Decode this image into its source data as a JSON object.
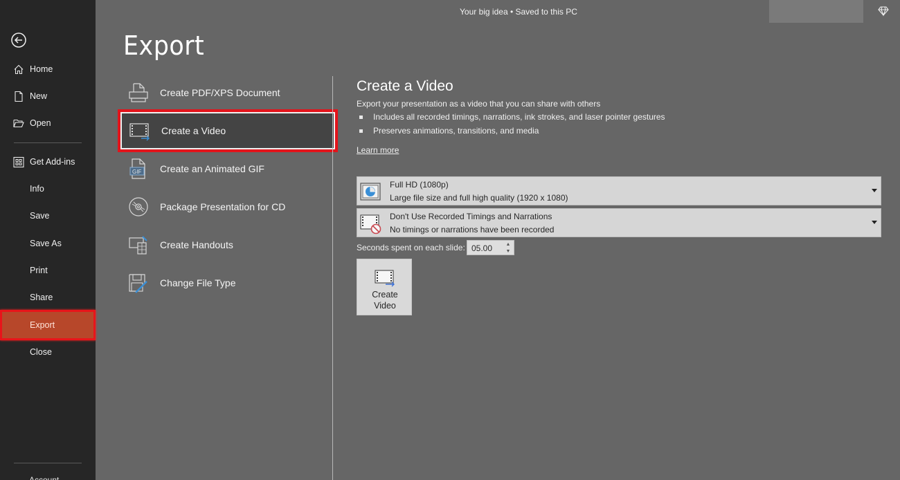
{
  "titlebar": {
    "document_status": "Your big idea  •  Saved to this PC"
  },
  "sidebar": {
    "items": [
      {
        "label": "Home",
        "icon": "home-icon"
      },
      {
        "label": "New",
        "icon": "new-document-icon"
      },
      {
        "label": "Open",
        "icon": "folder-open-icon"
      },
      {
        "label": "Get Add-ins",
        "icon": "add-ins-grid-icon"
      },
      {
        "label": "Info"
      },
      {
        "label": "Save"
      },
      {
        "label": "Save As"
      },
      {
        "label": "Print"
      },
      {
        "label": "Share"
      },
      {
        "label": "Export",
        "active": true
      },
      {
        "label": "Close"
      }
    ],
    "bottom_partial": "Account"
  },
  "page": {
    "title": "Export"
  },
  "export_options": [
    {
      "label": "Create PDF/XPS Document",
      "icon": "pdf-document-icon"
    },
    {
      "label": "Create a Video",
      "icon": "video-icon",
      "selected": true
    },
    {
      "label": "Create an Animated GIF",
      "icon": "gif-icon"
    },
    {
      "label": "Package Presentation for CD",
      "icon": "cd-icon"
    },
    {
      "label": "Create Handouts",
      "icon": "handouts-icon"
    },
    {
      "label": "Change File Type",
      "icon": "change-file-type-icon"
    }
  ],
  "detail": {
    "title": "Create a Video",
    "description": "Export your presentation as a video that you can share with others",
    "bullets": [
      "Includes all recorded timings, narrations, ink strokes, and laser pointer gestures",
      "Preserves animations, transitions, and media"
    ],
    "learn_more": "Learn more",
    "quality_dropdown": {
      "title": "Full HD (1080p)",
      "subtitle": "Large file size and full high quality (1920 x 1080)"
    },
    "timings_dropdown": {
      "title": "Don't Use Recorded Timings and Narrations",
      "subtitle": "No timings or narrations have been recorded"
    },
    "seconds_label": "Seconds spent on each slide:",
    "seconds_value": "05.00",
    "create_button": {
      "line1": "Create",
      "line2": "Video"
    }
  },
  "colors": {
    "sidebar_bg": "#262626",
    "main_bg": "#666666",
    "active_nav": "#b7472a",
    "highlight_red": "#e3141b",
    "accent_blue": "#3a8fd6"
  }
}
